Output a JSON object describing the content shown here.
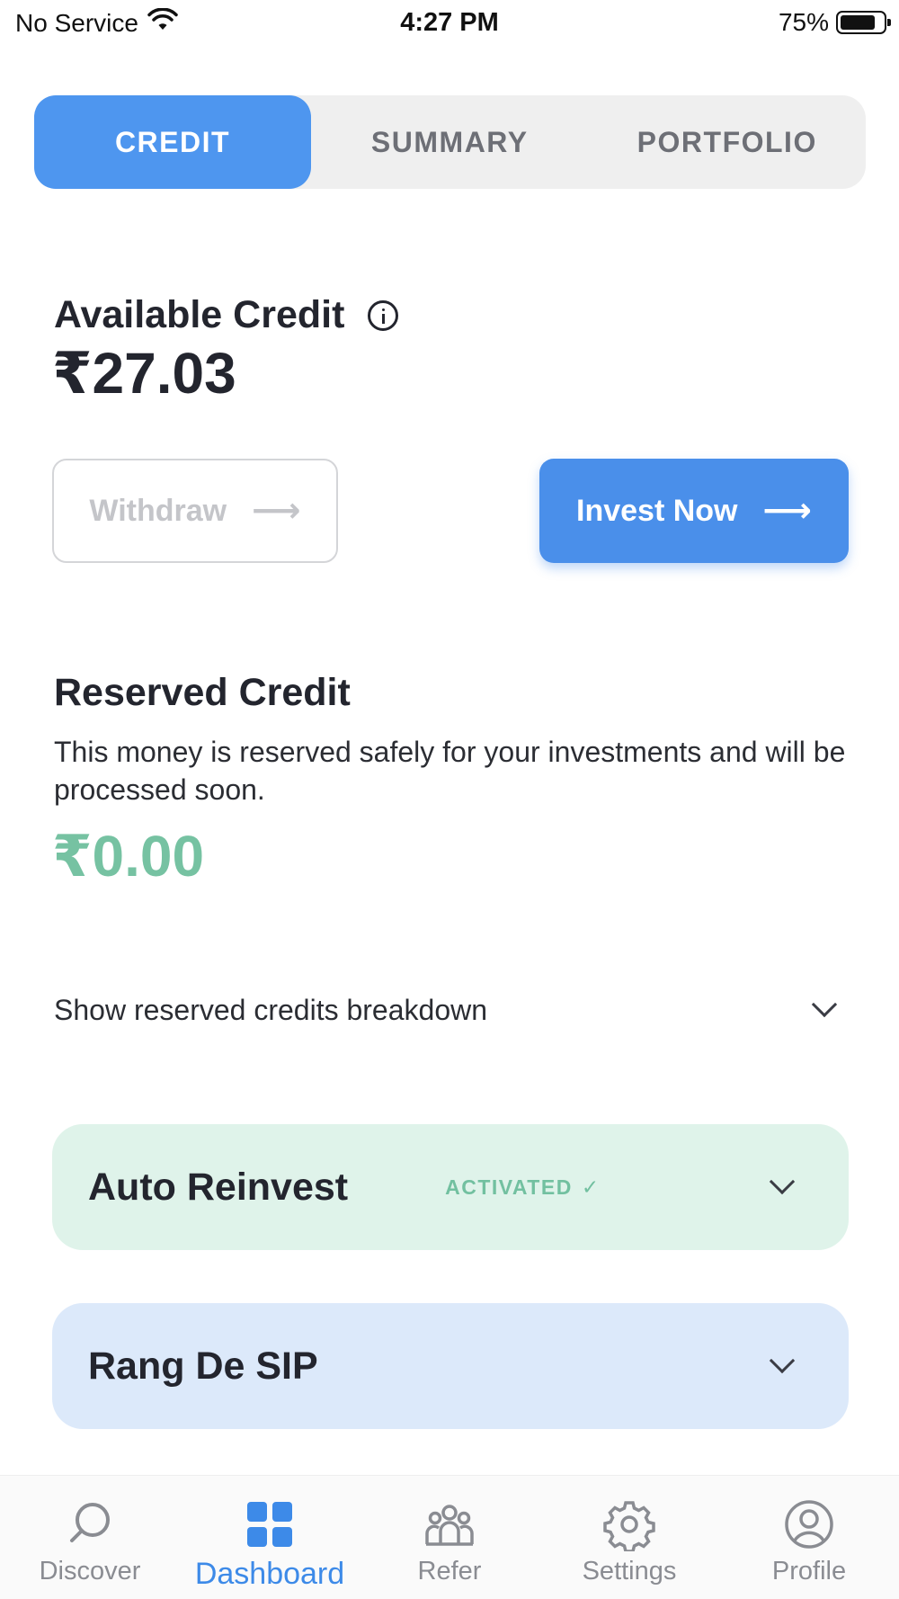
{
  "status_bar": {
    "carrier": "No Service",
    "time": "4:27 PM",
    "battery": "75%",
    "battery_level": 0.75
  },
  "tabs": [
    {
      "label": "CREDIT",
      "active": true
    },
    {
      "label": "SUMMARY",
      "active": false
    },
    {
      "label": "PORTFOLIO",
      "active": false
    }
  ],
  "available_credit": {
    "title": "Available Credit",
    "amount": "₹27.03",
    "info_icon": "info-icon"
  },
  "actions": {
    "withdraw_label": "Withdraw",
    "invest_label": "Invest Now",
    "arrow": "⟶"
  },
  "reserved_credit": {
    "title": "Reserved Credit",
    "description": "This money is reserved safely for your investments and will be processed soon.",
    "amount": "₹0.00"
  },
  "breakdown": {
    "label": "Show reserved credits breakdown"
  },
  "cards": {
    "auto_reinvest": {
      "title": "Auto Reinvest",
      "badge": "ACTIVATED",
      "badge_check": "✓"
    },
    "sip": {
      "title": "Rang De SIP"
    }
  },
  "bottom_nav": [
    {
      "label": "Discover",
      "icon": "search-icon",
      "active": false
    },
    {
      "label": "Dashboard",
      "icon": "grid-icon",
      "active": true
    },
    {
      "label": "Refer",
      "icon": "people-icon",
      "active": false
    },
    {
      "label": "Settings",
      "icon": "gear-icon",
      "active": false
    },
    {
      "label": "Profile",
      "icon": "user-icon",
      "active": false
    }
  ],
  "colors": {
    "accent": "#4a8fea",
    "reserved_green": "#76c2a2",
    "auto_card_bg": "#dff3ea",
    "sip_card_bg": "#dce9fa"
  }
}
